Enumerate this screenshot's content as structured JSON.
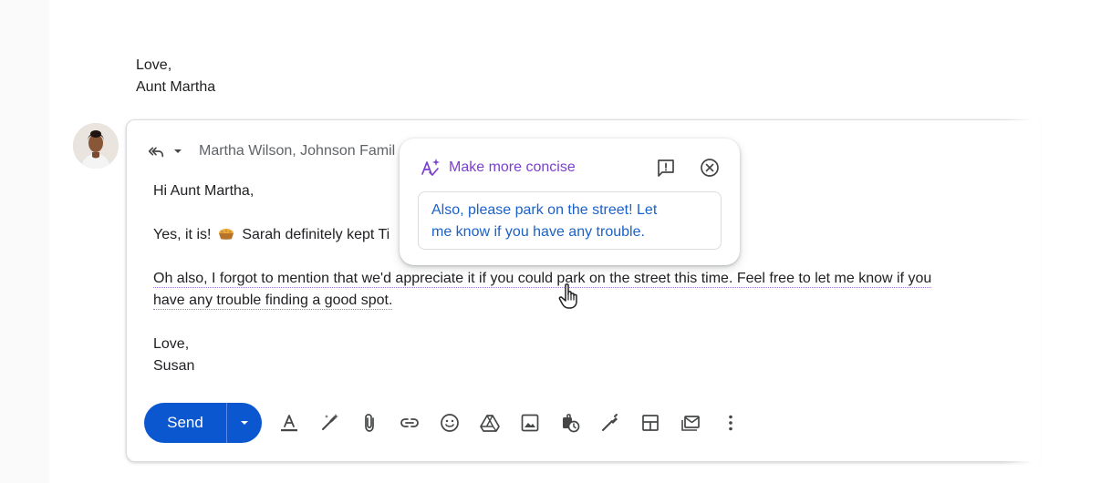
{
  "previous_message": {
    "closing": "Love,",
    "signature": "Aunt Martha"
  },
  "compose": {
    "recipients": "Martha Wilson, Johnson Famil",
    "greeting": "Hi Aunt Martha,",
    "line_1_prefix": "Yes, it is!",
    "line_1_suffix": "Sarah definitely kept Ti",
    "paragraph_line_1": "Oh also, I forgot to mention that we'd appreciate it if you could park on the street this time. Feel free to let me know if you",
    "paragraph_line_2": "have any trouble finding a good spot.",
    "closing": "Love,",
    "signature": "Susan"
  },
  "ai_popup": {
    "title": "Make more concise",
    "suggestion_line_1": "Also, please park on the street! Let",
    "suggestion_line_2": "me know if you have any trouble."
  },
  "toolbar": {
    "send_label": "Send",
    "icons": [
      "format-text-icon",
      "ai-write-icon",
      "attach-icon",
      "link-icon",
      "emoji-icon",
      "drive-icon",
      "image-icon",
      "confidential-icon",
      "signature-icon",
      "template-icon",
      "schedule-icon",
      "more-vert-icon"
    ]
  },
  "colors": {
    "send_button": "#0b57d0",
    "ai_accent": "#7b3fd1",
    "suggestion_text": "#1a62c9"
  }
}
